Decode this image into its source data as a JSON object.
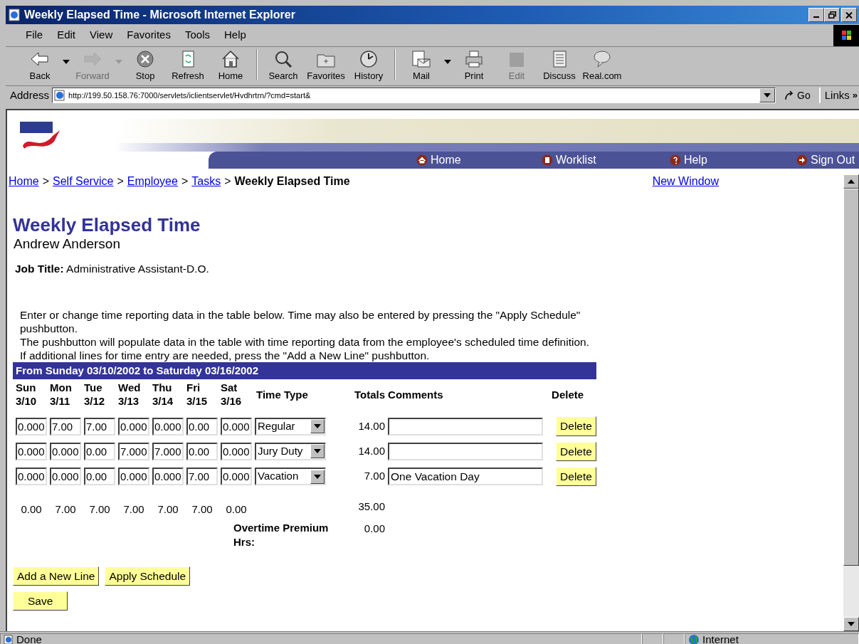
{
  "window": {
    "title": "Weekly Elapsed Time - Microsoft Internet Explorer"
  },
  "menu": [
    "File",
    "Edit",
    "View",
    "Favorites",
    "Tools",
    "Help"
  ],
  "toolbar": [
    {
      "label": "Back",
      "kind": "back",
      "disabled": false,
      "dropdown": true
    },
    {
      "label": "Forward",
      "kind": "forward",
      "disabled": true,
      "dropdown": true
    },
    {
      "label": "Stop",
      "kind": "stop",
      "disabled": false,
      "dropdown": false
    },
    {
      "label": "Refresh",
      "kind": "refresh",
      "disabled": false,
      "dropdown": false
    },
    {
      "label": "Home",
      "kind": "home",
      "disabled": false,
      "dropdown": false
    },
    {
      "label": "Search",
      "kind": "search",
      "disabled": false,
      "dropdown": false
    },
    {
      "label": "Favorites",
      "kind": "folder",
      "disabled": false,
      "dropdown": false
    },
    {
      "label": "History",
      "kind": "clock",
      "disabled": false,
      "dropdown": false
    },
    {
      "label": "Mail",
      "kind": "mail",
      "disabled": false,
      "dropdown": true
    },
    {
      "label": "Print",
      "kind": "print",
      "disabled": false,
      "dropdown": false
    },
    {
      "label": "Edit",
      "kind": "edit",
      "disabled": true,
      "dropdown": false
    },
    {
      "label": "Discuss",
      "kind": "doc",
      "disabled": false,
      "dropdown": false
    },
    {
      "label": "Real.com",
      "kind": "bubble",
      "disabled": false,
      "dropdown": false
    }
  ],
  "address": {
    "label": "Address",
    "value": "http://199.50.158.76:7000/servlets/iclientservlet/Hvdhrtrn/?cmd=start&"
  },
  "go": "Go",
  "links": "Links",
  "links_more": "»",
  "nav": [
    {
      "label": "Home",
      "kind": "home"
    },
    {
      "label": "Worklist",
      "kind": "worklist"
    },
    {
      "label": "Help",
      "kind": "help"
    },
    {
      "label": "Sign Out",
      "kind": "signout"
    }
  ],
  "breadcrumb": {
    "separator": ">",
    "items": [
      {
        "label": "Home",
        "link": true
      },
      {
        "label": "Self Service",
        "link": true
      },
      {
        "label": "Employee",
        "link": true
      },
      {
        "label": "Tasks",
        "link": true
      },
      {
        "label": "Weekly Elapsed Time",
        "link": false
      }
    ]
  },
  "new_window": "New Window",
  "page": {
    "title": "Weekly Elapsed Time",
    "employee": "Andrew Anderson",
    "job_title_label": "Job Title:",
    "job_title": "Administrative Assistant-D.O.",
    "instructions": [
      "Enter or change time reporting data in the table below. Time may also be entered by pressing the \"Apply Schedule\" pushbutton.",
      "The pushbutton will populate data in the table with time reporting data from the employee's scheduled time definition.",
      "If additional lines for time entry are needed, press the \"Add a New Line\" pushbutton."
    ]
  },
  "timesheet": {
    "period": "From Sunday 03/10/2002 to Saturday 03/16/2002",
    "days": [
      {
        "name": "Sun",
        "date": "3/10"
      },
      {
        "name": "Mon",
        "date": "3/11"
      },
      {
        "name": "Tue",
        "date": "3/12"
      },
      {
        "name": "Wed",
        "date": "3/13"
      },
      {
        "name": "Thu",
        "date": "3/14"
      },
      {
        "name": "Fri",
        "date": "3/15"
      },
      {
        "name": "Sat",
        "date": "3/16"
      }
    ],
    "columns": {
      "time_type": "Time Type",
      "totals": "Totals",
      "comments": "Comments",
      "delete": "Delete"
    },
    "rows": [
      {
        "hours": [
          "0.000",
          "7.00",
          "7.00",
          "0.000",
          "0.000",
          "0.00",
          "0.000"
        ],
        "time_type": "Regular",
        "total": "14.00",
        "delete": "Delete"
      },
      {
        "hours": [
          "0.000",
          "0.000",
          "0.00",
          "7.000",
          "7.000",
          "0.00",
          "0.000"
        ],
        "time_type": "Jury Duty",
        "total": "14.00",
        "delete": "Delete"
      },
      {
        "hours": [
          "0.000",
          "0.000",
          "0.00",
          "0.000",
          "0.000",
          "7.00",
          "0.000"
        ],
        "time_type": "Vacation",
        "total": "7.00",
        "comment": "One Vacation Day",
        "delete": "Delete"
      }
    ],
    "day_totals": [
      "0.00",
      "7.00",
      "7.00",
      "7.00",
      "7.00",
      "7.00",
      "0.00"
    ],
    "grand_total": "35.00",
    "overtime_label": "Overtime Premium Hrs:",
    "overtime": "0.00"
  },
  "buttons": [
    "Add a New Line",
    "Apply Schedule",
    "Save"
  ],
  "status_bar": {
    "text": "Done",
    "zone": "Internet"
  }
}
